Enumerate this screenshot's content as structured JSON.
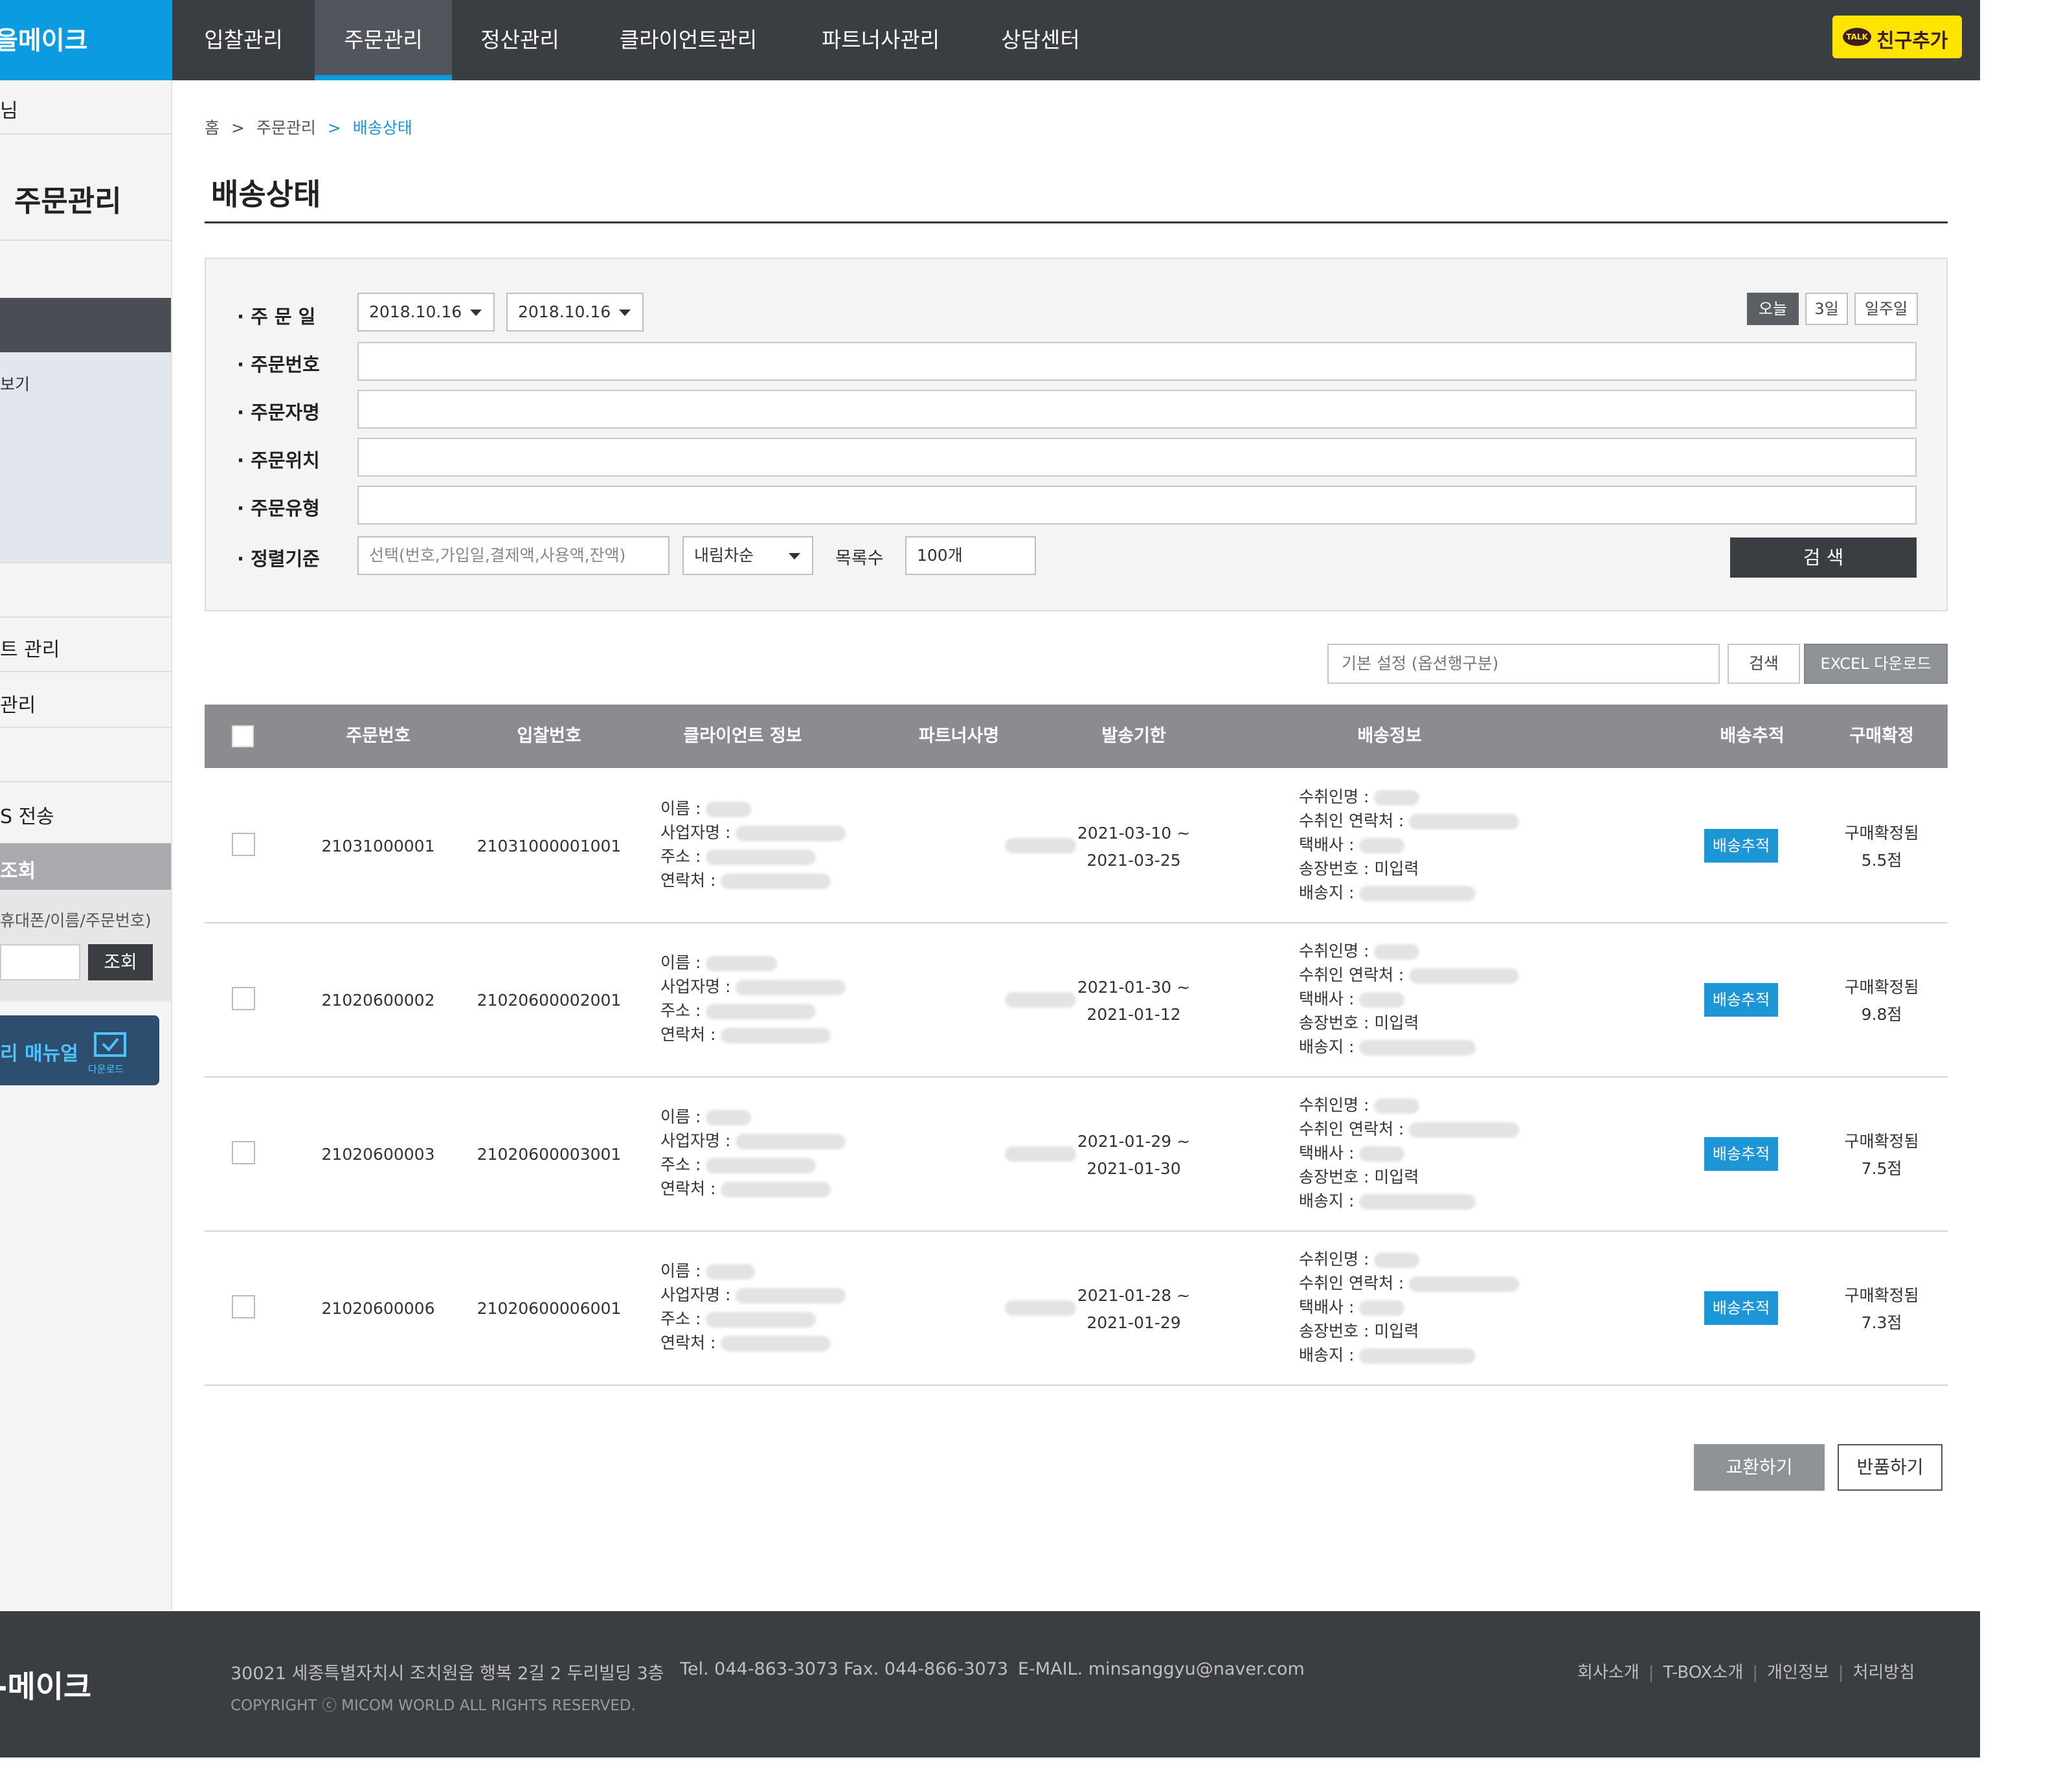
{
  "header": {
    "logo": "을메이크",
    "nav": [
      "입찰관리",
      "주문관리",
      "정산관리",
      "클라이언트관리",
      "파트너사관리",
      "상담센터"
    ],
    "active_nav": "주문관리",
    "kakao_badge": "TALK",
    "kakao_label": "친구추가"
  },
  "sidebar": {
    "greeting": "님",
    "section_title": "주문관리",
    "menu_view": "보기",
    "menu_client": "트 관리",
    "menu_manage": "관리",
    "menu_sms": "S 전송",
    "lookup_title": "조회",
    "lookup_hint": "휴대폰/이름/주문번호)",
    "lookup_button": "조회",
    "manual_label": "리 매뉴얼",
    "manual_download": "다운로드"
  },
  "breadcrumb": {
    "home": "홈",
    "sep": ">",
    "parent": "주문관리",
    "current": "배송상태"
  },
  "page_title": "배송상태",
  "filter": {
    "labels": {
      "order_date": "주 문 일",
      "order_no": "주문번호",
      "orderer": "주문자명",
      "location": "주문위치",
      "type": "주문유형",
      "sort": "정렬기준"
    },
    "date_from": "2018.10.16",
    "date_to": "2018.10.16",
    "quick_buttons": [
      "오늘",
      "3일",
      "일주일"
    ],
    "sort_placeholder": "선택(번호,가입일,결제액,사용액,잔액)",
    "sort_order": "내림차순",
    "count_label": "목록수",
    "count_value": "100개",
    "search_button": "검 색"
  },
  "tools": {
    "option_placeholder": "기본 설정 (옵션행구분)",
    "search": "검색",
    "excel": "EXCEL 다운로드"
  },
  "table": {
    "headers": [
      "주문번호",
      "입찰번호",
      "클라이언트 정보",
      "파트너사명",
      "발송기한",
      "배송정보",
      "배송추적",
      "구매확정"
    ],
    "client_fields": [
      "이름 :",
      "사업자명 :",
      "주소 :",
      "연락처 :"
    ],
    "delivery_fields": [
      "수취인명 :",
      "수취인 연락처 :",
      "택배사 :",
      "송장번호 :",
      "배송지 :"
    ],
    "rows": [
      {
        "order_no": "21031000001",
        "bid_no": "21031000001001",
        "ship_start": "2021-03-10 ~",
        "ship_end": "2021-03-25",
        "invoice": "미입력",
        "track": "배송추적",
        "confirm": "구매확정됨",
        "score": "5.5점"
      },
      {
        "order_no": "21020600002",
        "bid_no": "21020600002001",
        "ship_start": "2021-01-30 ~",
        "ship_end": "2021-01-12",
        "invoice": "미입력",
        "track": "배송추적",
        "confirm": "구매확정됨",
        "score": "9.8점"
      },
      {
        "order_no": "21020600003",
        "bid_no": "21020600003001",
        "ship_start": "2021-01-29 ~",
        "ship_end": "2021-01-30",
        "invoice": "미입력",
        "track": "배송추적",
        "confirm": "구매확정됨",
        "score": "7.5점"
      },
      {
        "order_no": "21020600006",
        "bid_no": "21020600006001",
        "ship_start": "2021-01-28 ~",
        "ship_end": "2021-01-29",
        "invoice": "미입력",
        "track": "배송추적",
        "confirm": "구매확정됨",
        "score": "7.3점"
      }
    ]
  },
  "actions": {
    "exchange": "교환하기",
    "return": "반품하기"
  },
  "footer": {
    "logo": "-메이크",
    "address": "30021 세종특별자치시 조치원읍 행복 2길 2 두리빌딩 3층",
    "tel": "Tel. 044-863-3073 Fax. 044-866-3073",
    "email": "E-MAIL. minsanggyu@naver.com",
    "copyright": "COPYRIGHT ⓒ MICOM WORLD ALL RIGHTS RESERVED.",
    "links": [
      "회사소개",
      "T-BOX소개",
      "개인정보",
      "처리방침"
    ]
  }
}
